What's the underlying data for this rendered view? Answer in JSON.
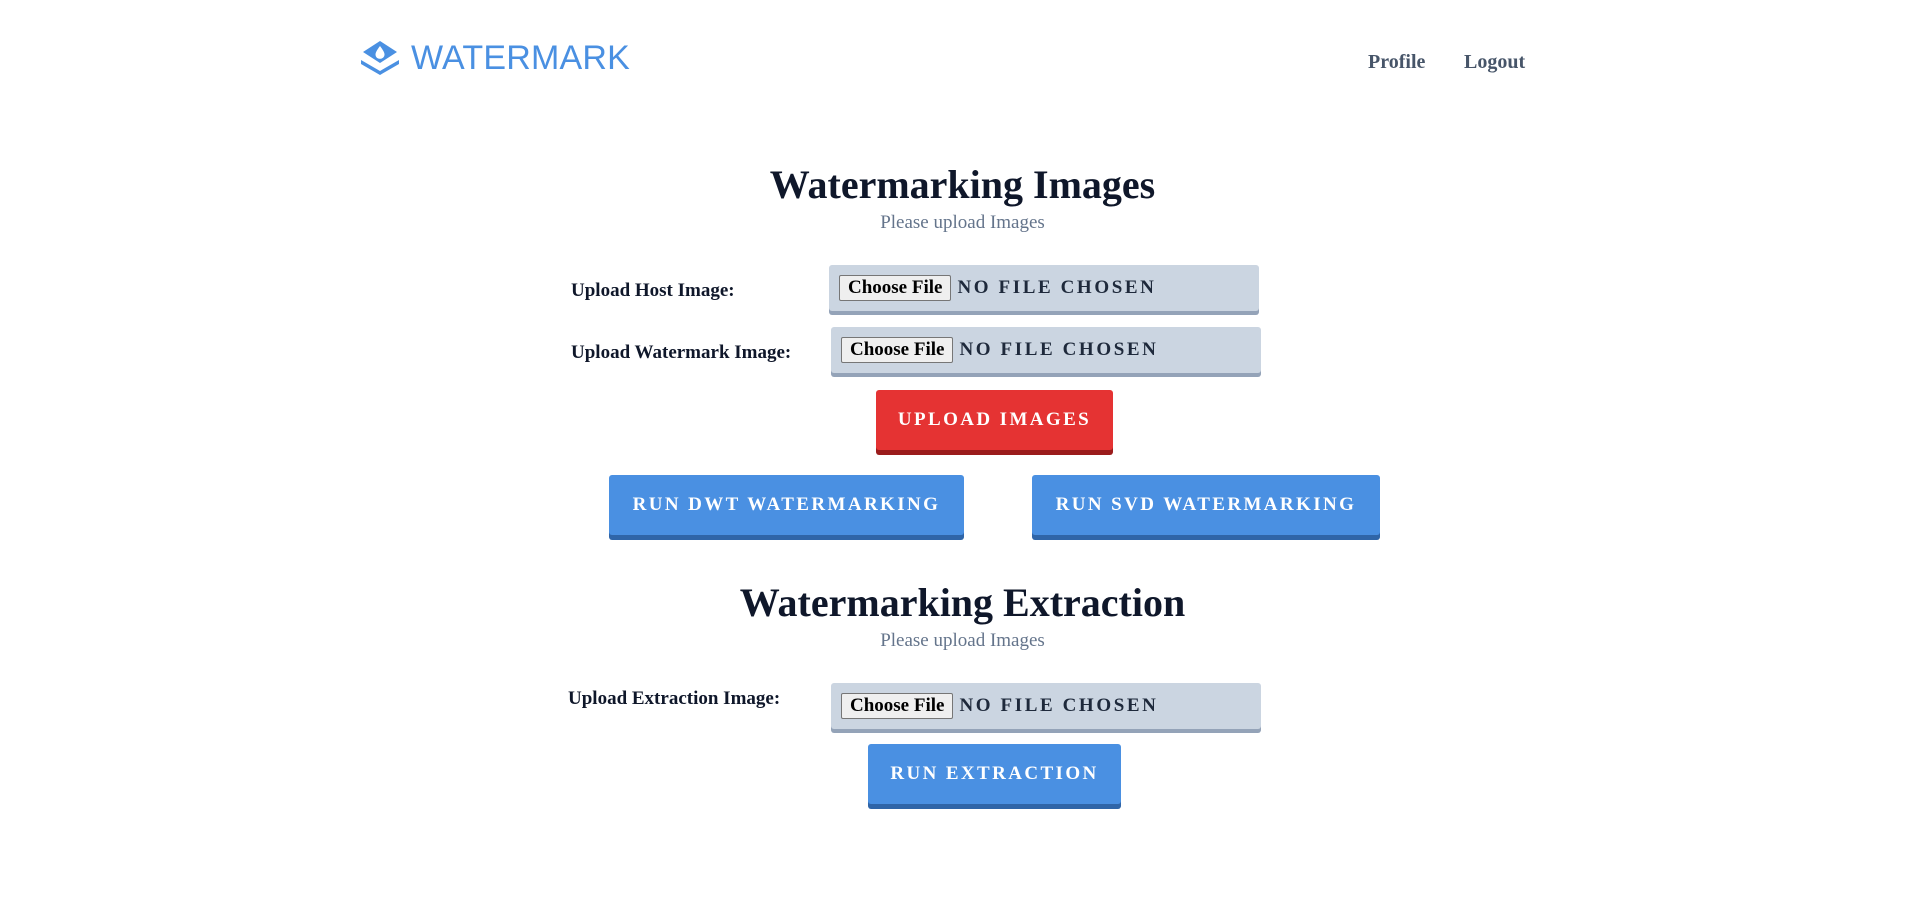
{
  "header": {
    "brand": "WATERMARK",
    "brand_icon": "layers-icon",
    "brand_color": "#4a90e2",
    "nav": {
      "profile": "Profile",
      "logout": "Logout"
    }
  },
  "embed_section": {
    "title": "Watermarking Images",
    "subtitle": "Please upload Images",
    "host_label": "Upload Host Image:",
    "watermark_label": "Upload Watermark Image:",
    "choose_file": "Choose File",
    "no_file": "No file chosen",
    "upload_button": "Upload Images",
    "dwt_button": "Run DWT Watermarking",
    "svd_button": "Run SVD Watermarking"
  },
  "extract_section": {
    "title": "Watermarking Extraction",
    "subtitle": "Please upload Images",
    "extraction_label": "Upload Extraction Image:",
    "choose_file": "Choose File",
    "no_file": "No file chosen",
    "run_button": "Run Extraction"
  },
  "colors": {
    "accent_blue": "#4a90e2",
    "danger_red": "#e53333",
    "input_bg": "#cbd5e1"
  }
}
